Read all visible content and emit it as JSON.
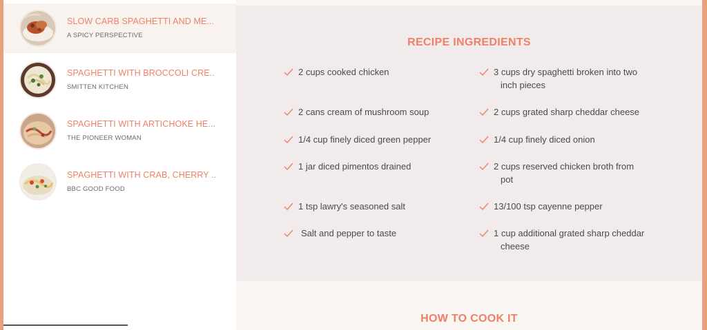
{
  "sidebar": {
    "items": [
      {
        "title": "SLOW CARB SPAGHETTI AND ME...",
        "source": "A SPICY PERSPECTIVE",
        "thumb_icon": "recipe-photo",
        "active": true
      },
      {
        "title": "SPAGHETTI WITH BROCCOLI CRE...",
        "source": "SMITTEN KITCHEN",
        "thumb_icon": "recipe-photo",
        "active": false
      },
      {
        "title": "SPAGHETTI WITH ARTICHOKE HE...",
        "source": "THE PIONEER WOMAN",
        "thumb_icon": "recipe-photo",
        "active": false
      },
      {
        "title": "SPAGHETTI WITH CRAB, CHERRY ...",
        "source": "BBC GOOD FOOD",
        "thumb_icon": "recipe-photo",
        "active": false
      }
    ]
  },
  "ingredients": {
    "title": "RECIPE INGREDIENTS",
    "check_icon": "check-icon",
    "left": [
      {
        "text": "2 cups cooked chicken"
      },
      {
        "text": "2 cans cream of mushroom soup"
      },
      {
        "text": "1/4 cup finely diced green pepper"
      },
      {
        "text": "1 jar diced pimentos drained"
      },
      {
        "text": "1 tsp lawry's seasoned salt"
      },
      {
        "text": "Salt and pepper to taste"
      }
    ],
    "right": [
      {
        "line1": "3 cups dry spaghetti broken into two",
        "line2": "inch pieces"
      },
      {
        "line1": "2 cups grated sharp cheddar cheese",
        "line2": ""
      },
      {
        "line1": "1/4 cup finely diced onion",
        "line2": ""
      },
      {
        "line1": "2 cups reserved chicken broth from",
        "line2": "pot"
      },
      {
        "line1": "13/100 tsp cayenne pepper",
        "line2": ""
      },
      {
        "line1": "1 cup additional grated sharp cheddar",
        "line2": "cheese"
      }
    ]
  },
  "cook": {
    "title": "HOW TO COOK IT"
  },
  "colors": {
    "accent": "#f07f66",
    "border": "#e8a07d",
    "section_bg": "#f1eceb"
  }
}
